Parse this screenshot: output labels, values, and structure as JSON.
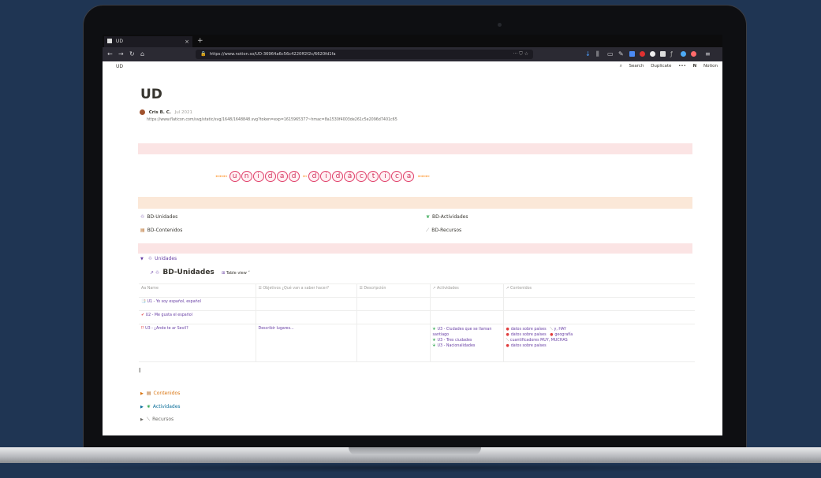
{
  "browser": {
    "tab_title": "UD",
    "new_tab_symbol": "+",
    "url": "https://www.notion.so/UD-3696​4a6c56c4220ff2f2c/6620fd1fa",
    "url_extra": "··· ⛉ ☆"
  },
  "notion_top": {
    "breadcrumb": "UD",
    "search": "Search",
    "duplicate": "Duplicate",
    "more": "•••",
    "brand": "Notion"
  },
  "page": {
    "title": "UD",
    "author": "Cris B. C.",
    "author_date": "Jul 2021",
    "link": "https://www.flaticon.com/svg/static/svg/1648/1648848.svg?token=exp=1615965377~hmac=8a1530f4003de261c5e2096d7401c65"
  },
  "banner": {
    "word1": [
      "u",
      "n",
      "i",
      "d",
      "a",
      "d"
    ],
    "word2": [
      "d",
      "i",
      "d",
      "á",
      "c",
      "t",
      "i",
      "c",
      "a"
    ],
    "arrows_left": "➳➳➳",
    "arrows_mid": "➳",
    "arrows_right": "➳➳➳"
  },
  "db_links": {
    "unidades": "BD-Unidades",
    "actividades": "BD-Actividades",
    "contenidos": "BD-Contenidos",
    "recursos": "BD-Recursos"
  },
  "toggle_unidades": "Unidades",
  "database": {
    "title": "BD-Unidades",
    "view": "Table view",
    "columns": [
      "Aa Name",
      "☰ Objetivos ¿Qué van a saber hacer?",
      "☰ Descripción",
      "↗ Actividades",
      "↗ Contenidos"
    ],
    "rows": [
      {
        "name": "U1 - Yo soy español, español",
        "icon": "📑",
        "objetivos": "",
        "descripcion": "",
        "actividades": [],
        "contenidos": []
      },
      {
        "name": "U2 - Me gusta el español",
        "icon": "✔",
        "objetivos": "",
        "descripcion": "",
        "actividades": [],
        "contenidos": []
      },
      {
        "name": "U3 - ¿Ande te ar Sevil?",
        "icon": "⁉",
        "objetivos": "Describir lugares...",
        "descripcion": "",
        "actividades": [
          "U3 - Ciudades que se llaman santiago",
          "U3 - Tres ciudades",
          "U3 - Nacionalidades"
        ],
        "contenidos": [
          "datos sobre países",
          "datos sobre países",
          "cuantificadores MUY, MUCHAS",
          "datos sobre países"
        ],
        "contenidos_extra": [
          "y, HAY",
          "geografía"
        ]
      }
    ]
  },
  "subsections": {
    "contenidos": "Contenidos",
    "actividades": "Actividades",
    "recursos": "Recursos"
  },
  "colors": {
    "band_pink": "#fbe4e4",
    "band_peach": "#fbe8d8",
    "purple": "#6940a5",
    "orange": "#d9730d",
    "blue": "#0b6e99"
  }
}
